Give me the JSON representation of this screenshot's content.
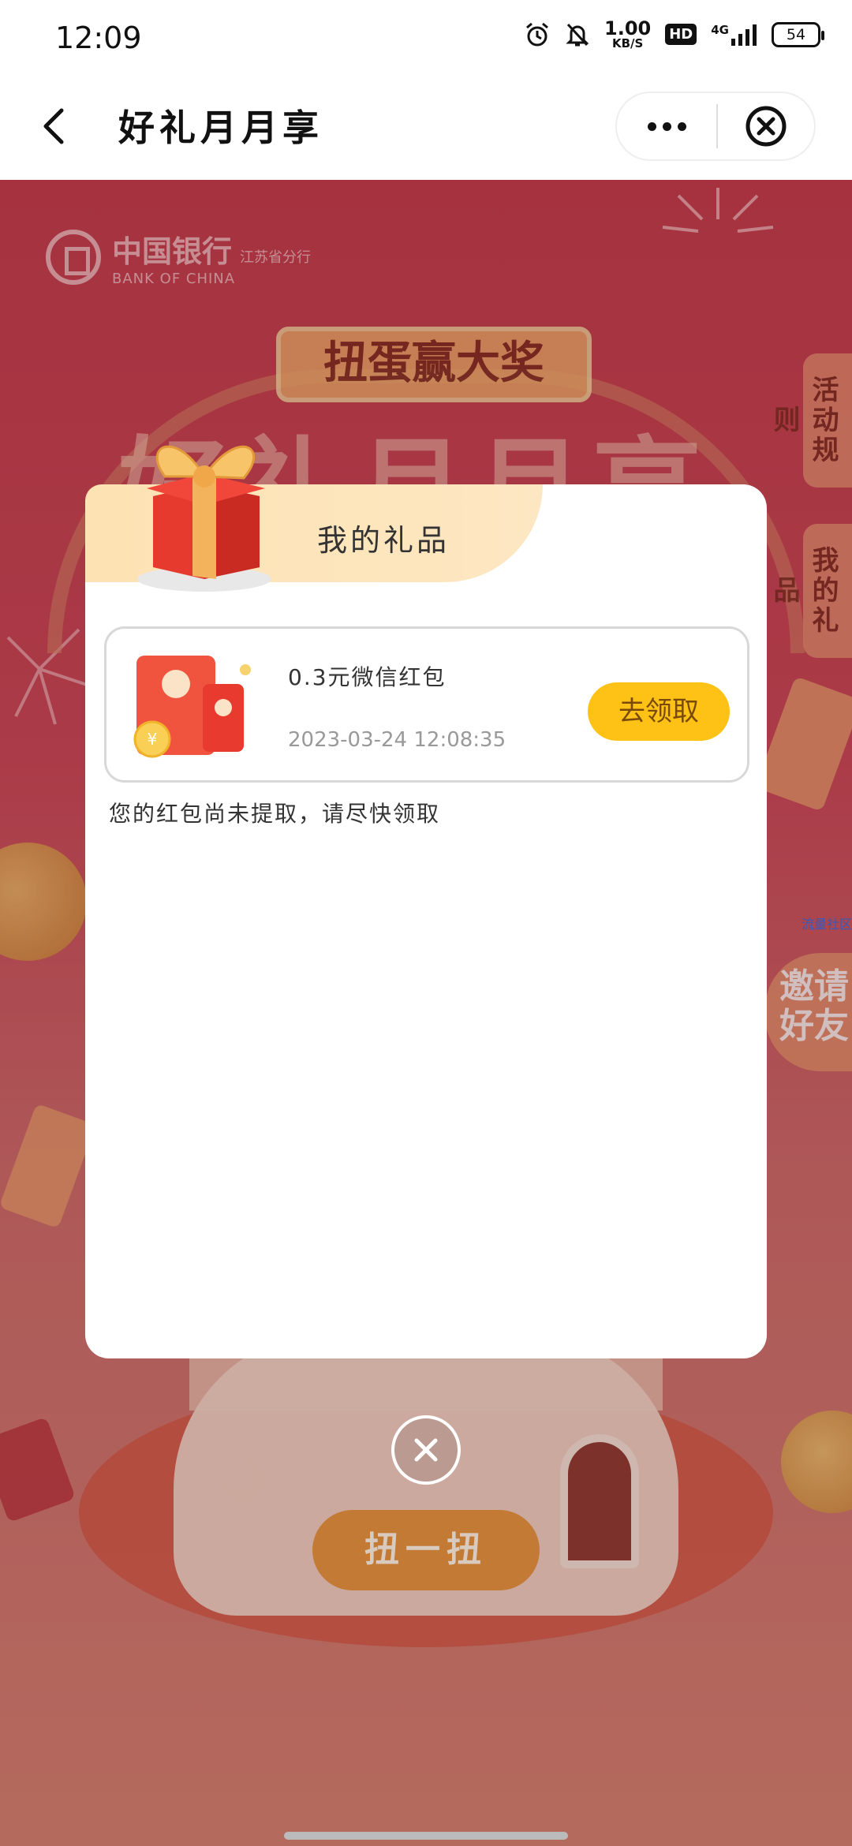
{
  "status_bar": {
    "time": "12:09",
    "net_speed_value": "1.00",
    "net_speed_unit": "KB/S",
    "hd_label": "HD",
    "network": "4G",
    "battery": "54"
  },
  "nav": {
    "title": "好礼月月享"
  },
  "background": {
    "bank_name_cn": "中国银行",
    "bank_name_en": "BANK OF CHINA",
    "branch": "江苏省分行",
    "banner": "扭蛋赢大奖",
    "big_title": "好礼月月享",
    "tab_rules": "活动规则",
    "tab_gifts": "我的礼品",
    "side_link": "流量社区",
    "invite": "邀请好友",
    "spin_button": "扭一扭"
  },
  "modal": {
    "title": "我的礼品",
    "gift": {
      "name": "0.3元微信红包",
      "time": "2023-03-24 12:08:35",
      "claim_label": "去领取"
    },
    "notice": "您的红包尚未提取，请尽快领取"
  },
  "colors": {
    "accent_yellow": "#fdc215",
    "header_cream": "#fde2b3",
    "background_red": "#c23b4b"
  }
}
